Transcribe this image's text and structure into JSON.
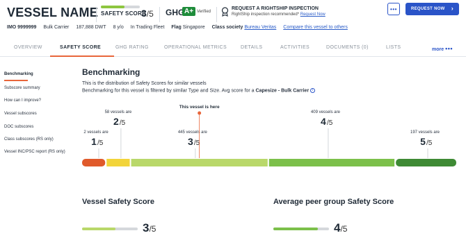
{
  "header": {
    "vessel_name": "VESSEL NAME",
    "safety_label": "SAFETY SCORE",
    "safety_score": "3",
    "safety_den": "/5",
    "safety_fraction": 0.6,
    "ghg_label": "GHG",
    "ghg_rating": "A+",
    "ghg_verified": "Verified",
    "inspection_title": "REQUEST A RIGHTSHIP INSPECTION",
    "inspection_text": "RightShip inspection recommended*",
    "inspection_link": "Request Now",
    "more_label": "•••",
    "request_label": "REQUEST NOW",
    "request_chevron": "›"
  },
  "info": {
    "imo": "IMO 9999999",
    "type": "Bulk Carrier",
    "dwt": "187,888 DWT",
    "age": "8 y/o",
    "status": "In Trading Fleet",
    "flag_label": "Flag",
    "flag_value": "Singapore",
    "class_label": "Class society",
    "class_value": "Bureau Veritas",
    "compare_link": "Compare this vessel to others"
  },
  "tabs": [
    {
      "label": "OVERVIEW"
    },
    {
      "label": "SAFETY SCORE"
    },
    {
      "label": "GHG RATING"
    },
    {
      "label": "OPERATIONAL METRICS"
    },
    {
      "label": "DETAILS"
    },
    {
      "label": "ACTIVITIES"
    },
    {
      "label": "DOCUMENTS (0)"
    },
    {
      "label": "LISTS"
    }
  ],
  "tab_more": "more",
  "tab_more_dots": "•••",
  "sidebar": [
    {
      "label": "Benchmarking"
    },
    {
      "label": "Subscore summary"
    },
    {
      "label": "How can I improve?"
    },
    {
      "label": "Vessel subscores"
    },
    {
      "label": "DOC subscores"
    },
    {
      "label": "Class subscores (RS only)"
    },
    {
      "label": "Vessel INC/PSC report (RS only)"
    }
  ],
  "benchmark": {
    "title": "Benchmarking",
    "desc1": "This is the distribution of Safety Scores for similar vessels",
    "desc2_prefix": "Benchmarking for this vessel is filtered by similar Type and Size. Avg score for a",
    "desc2_bold": "Capesize - Bulk Carrier",
    "info_icon": "i"
  },
  "chart_data": {
    "type": "bar",
    "categories": [
      "1",
      "2",
      "3",
      "4",
      "5"
    ],
    "values": [
      2,
      58,
      445,
      409,
      197
    ],
    "score_text": [
      "1",
      "2",
      "3",
      "4",
      "5"
    ],
    "count_labels": [
      "2 vessels are",
      "58 vessels are",
      "445 vessels are",
      "409 vessels are",
      "197 vessels are"
    ],
    "denominator": "/5",
    "this_vessel_label": "This vessel is here",
    "this_vessel_score": 3,
    "colors": [
      "#e05a2b",
      "#f2d43a",
      "#b9d86a",
      "#7cc04a",
      "#3e8a34"
    ]
  },
  "cards": {
    "vessel": {
      "title": "Vessel Safety Score",
      "score": "3",
      "den": "/5",
      "fraction": 0.6,
      "color": "#b9d86a"
    },
    "peer": {
      "title": "Average peer group Safety Score",
      "score": "4",
      "den": "/5",
      "fraction": 0.8,
      "color": "#7cc04a"
    }
  }
}
